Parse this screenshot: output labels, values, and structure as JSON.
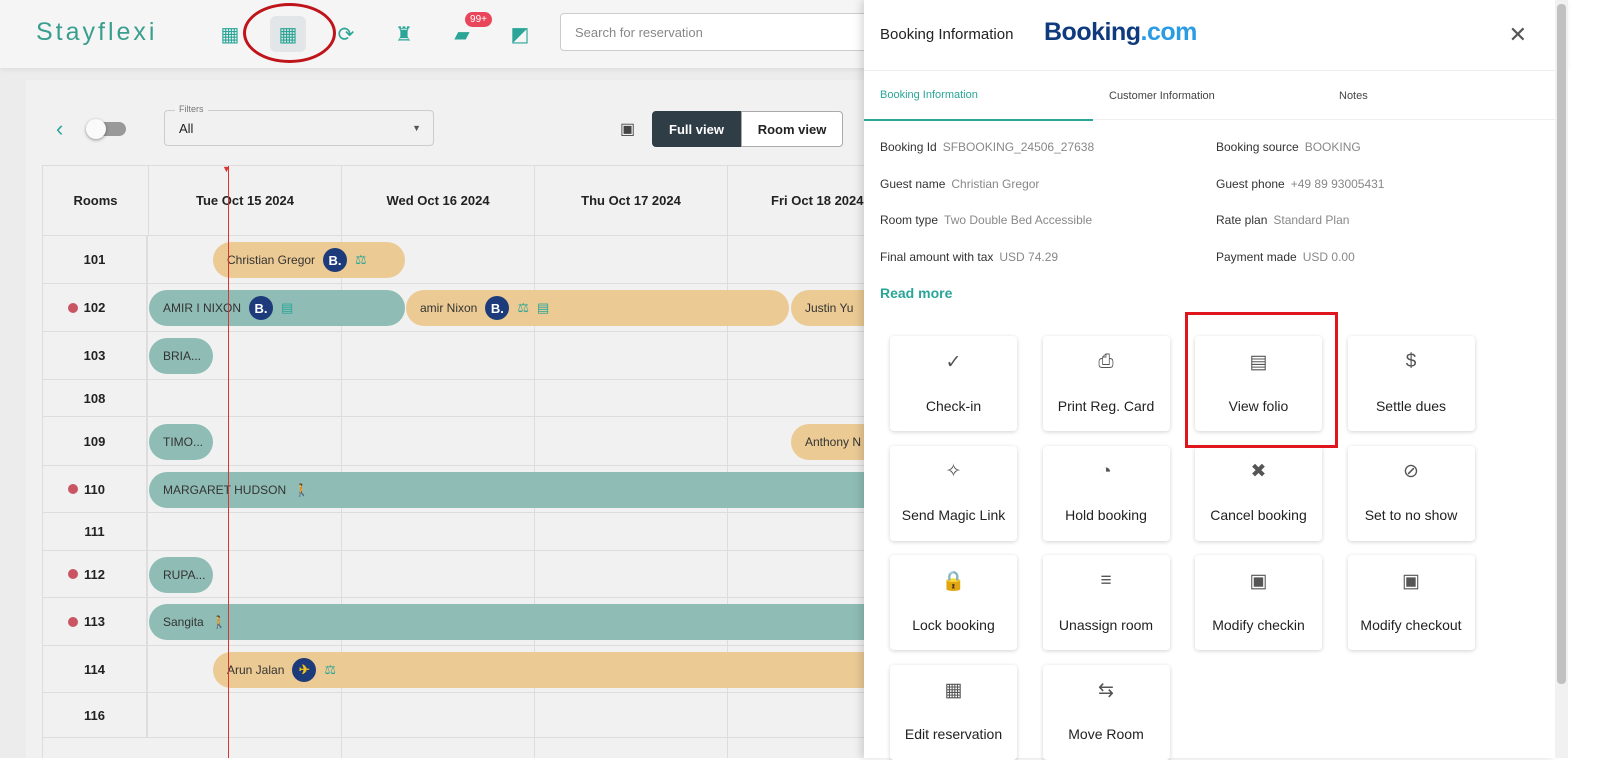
{
  "header": {
    "logo": "Stayflexi",
    "search_placeholder": "Search for reservation",
    "notification_badge": "99+",
    "nav_icons": [
      "dashboard-icon",
      "calendar-icon",
      "calendar-sync-icon",
      "luggage-icon",
      "chat-icon",
      "report-icon"
    ]
  },
  "calendar": {
    "filter_label": "Filters",
    "filter_value": "All",
    "views": {
      "full": "Full view",
      "room": "Room view",
      "active": "Full view"
    },
    "rooms_header": "Rooms",
    "dates": [
      "Tue Oct 15 2024",
      "Wed Oct 16 2024",
      "Thu Oct 17 2024",
      "Fri Oct 18 2024"
    ],
    "rooms": [
      {
        "no": "101",
        "dot": false
      },
      {
        "no": "102",
        "dot": true
      },
      {
        "no": "103",
        "dot": false
      },
      {
        "no": "108",
        "dot": false
      },
      {
        "no": "109",
        "dot": false
      },
      {
        "no": "110",
        "dot": true
      },
      {
        "no": "111",
        "dot": false
      },
      {
        "no": "112",
        "dot": true
      },
      {
        "no": "113",
        "dot": true
      },
      {
        "no": "114",
        "dot": false
      },
      {
        "no": "116",
        "dot": false
      }
    ],
    "bookings": [
      {
        "name": "Christian Gregor",
        "room": "101"
      },
      {
        "name": "AMIR I NIXON",
        "room": "102"
      },
      {
        "name": "amir Nixon",
        "room": "102"
      },
      {
        "name": "Justin Yu",
        "room": "102"
      },
      {
        "name": "BRIA...",
        "room": "103"
      },
      {
        "name": "TIMO...",
        "room": "109"
      },
      {
        "name": "Anthony N",
        "room": "109"
      },
      {
        "name": "MARGARET HUDSON",
        "room": "110"
      },
      {
        "name": "RUPA...",
        "room": "112"
      },
      {
        "name": "Sangita",
        "room": "113"
      },
      {
        "name": "Arun Jalan",
        "room": "114"
      }
    ],
    "colors": {
      "checked_in": "#8fbdb6",
      "reserved": "#ecca94",
      "today_line": "#dd3333"
    }
  },
  "panel": {
    "title": "Booking Information",
    "brand_main": "Booking",
    "brand_suffix": ".com",
    "tabs": [
      "Booking Information",
      "Customer Information",
      "Notes"
    ],
    "active_tab": "Booking Information",
    "fields": [
      {
        "label": "Booking Id",
        "value": "SFBOOKING_24506_27638"
      },
      {
        "label": "Booking source",
        "value": "BOOKING"
      },
      {
        "label": "Guest name",
        "value": "Christian Gregor"
      },
      {
        "label": "Guest phone",
        "value": "+49 89 93005431"
      },
      {
        "label": "Room type",
        "value": "Two Double Bed Accessible"
      },
      {
        "label": "Rate plan",
        "value": "Standard Plan"
      },
      {
        "label": "Final amount with tax",
        "value": "USD 74.29"
      },
      {
        "label": "Payment made",
        "value": "USD 0.00"
      }
    ],
    "read_more": "Read more",
    "actions": [
      "Check-in",
      "Print Reg. Card",
      "View folio",
      "Settle dues",
      "Send Magic Link",
      "Hold booking",
      "Cancel booking",
      "Set to no show",
      "Lock booking",
      "Unassign room",
      "Modify checkin",
      "Modify checkout",
      "Edit reservation",
      "Move Room"
    ],
    "highlighted_action": "View folio"
  }
}
